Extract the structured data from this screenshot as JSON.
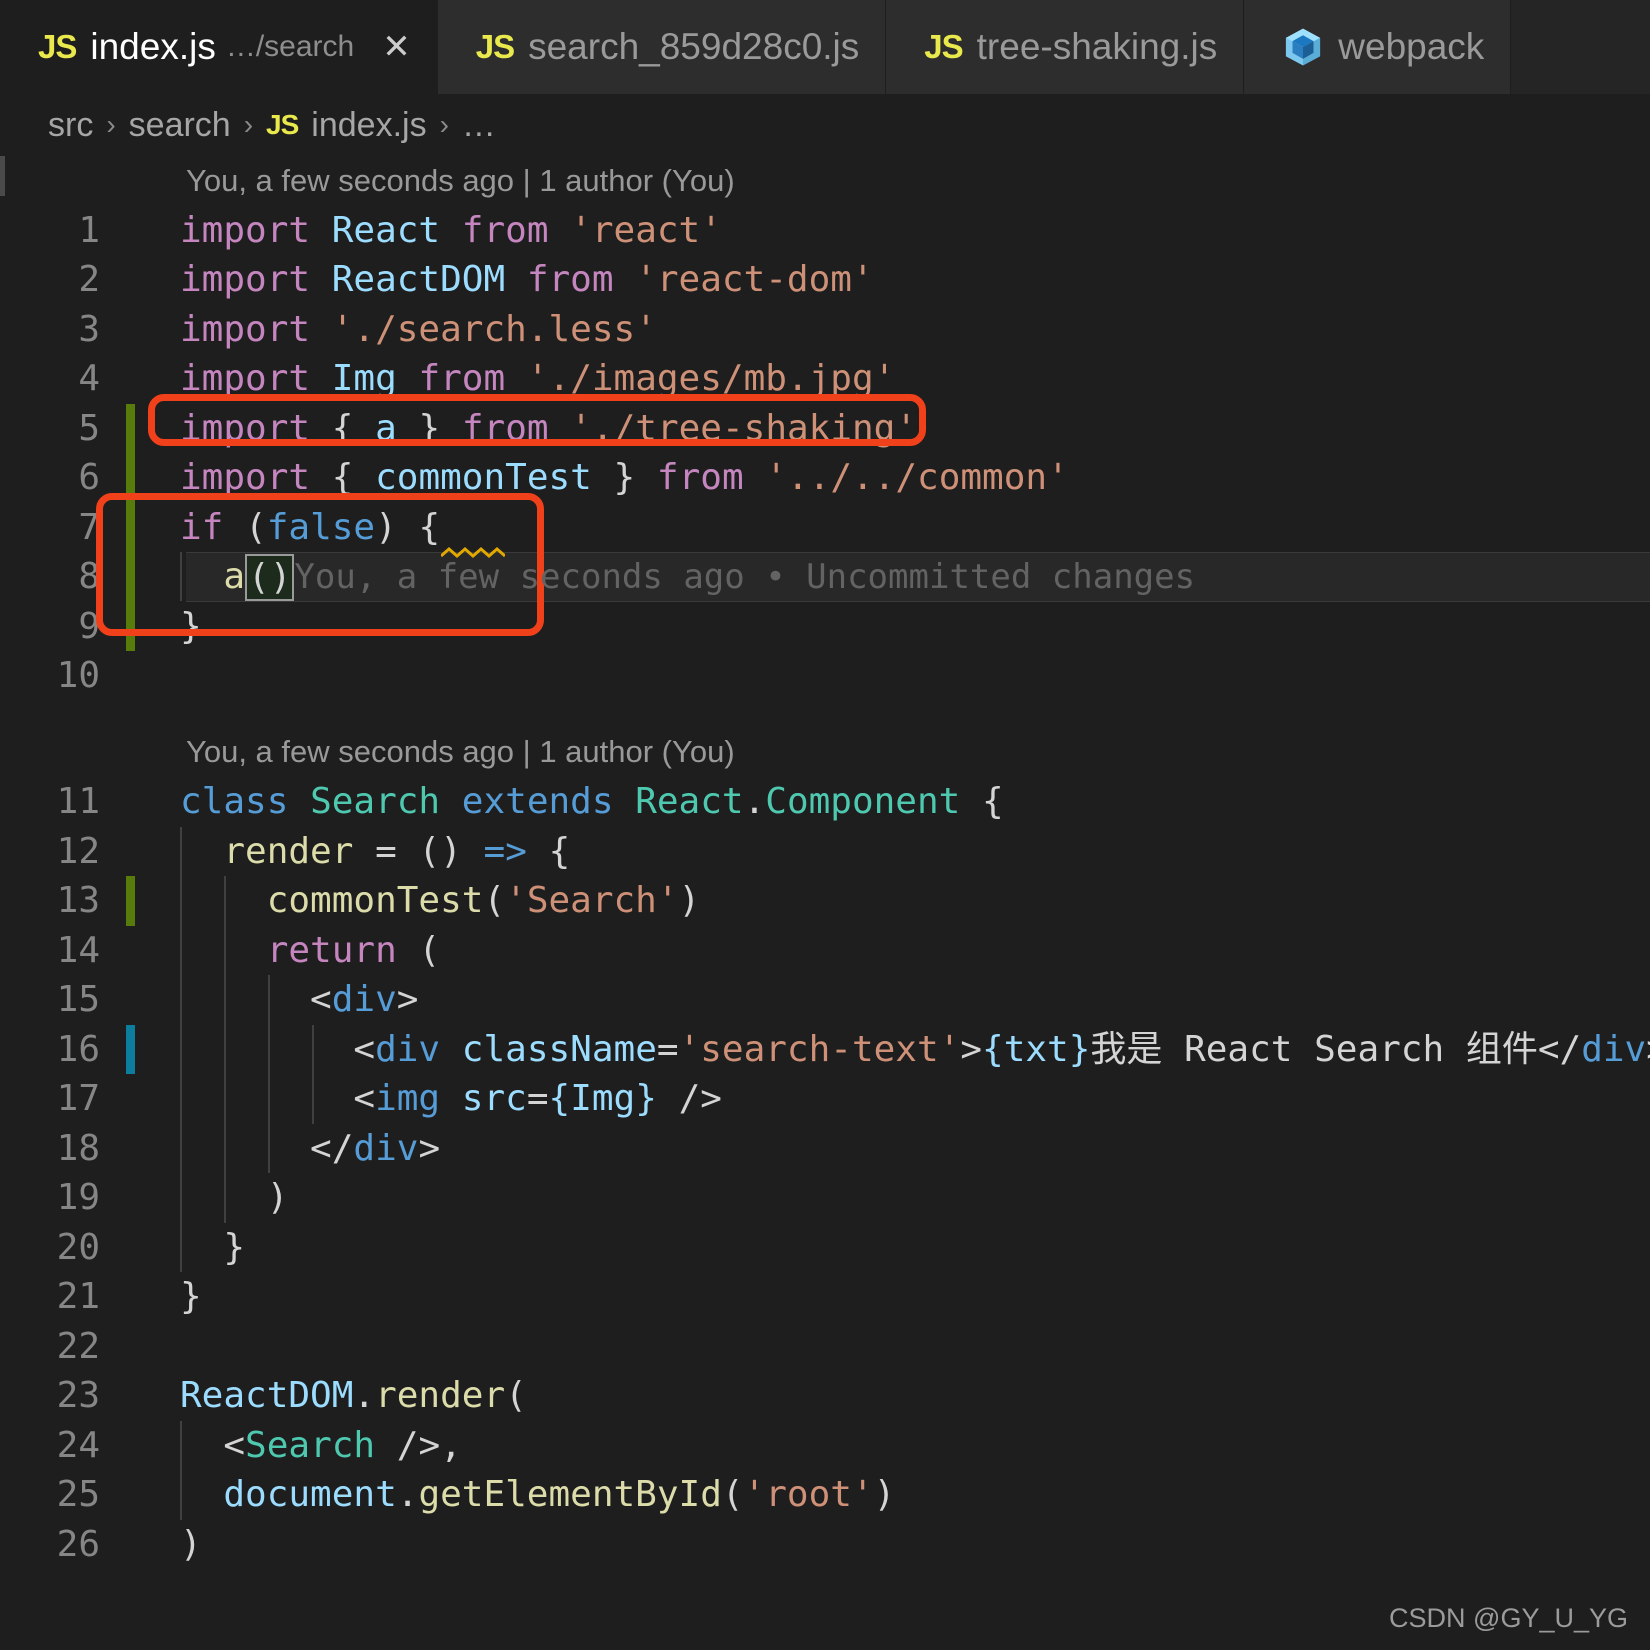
{
  "window": {
    "theme": "vscode-dark",
    "accent_js": "#e9e84c",
    "annotation_color": "#f0411b",
    "git_added_color": "#587c0c",
    "git_modified_color": "#0c7d9d"
  },
  "tabs": [
    {
      "icon": "js-file-icon",
      "label": "index.js",
      "desc": "…/search",
      "active": true,
      "close": "✕"
    },
    {
      "icon": "js-file-icon",
      "label": "search_859d28c0.js",
      "desc": "",
      "active": false,
      "close": ""
    },
    {
      "icon": "js-file-icon",
      "label": "tree-shaking.js",
      "desc": "",
      "active": false,
      "close": ""
    },
    {
      "icon": "webpack-icon",
      "label": "webpack",
      "desc": "",
      "active": false,
      "close": ""
    }
  ],
  "breadcrumb": {
    "parts": [
      "src",
      "search",
      "index.js",
      "…"
    ],
    "separator": "›",
    "file_icon_label": "JS"
  },
  "blame_headers": {
    "top": "You, a few seconds ago | 1 author (You)",
    "class": "You, a few seconds ago | 1 author (You)",
    "inline_line8": "You, a few seconds ago • Uncommitted changes"
  },
  "code_lines": [
    {
      "n": 1,
      "git": "none",
      "text": "import React from 'react'"
    },
    {
      "n": 2,
      "git": "none",
      "text": "import ReactDOM from 'react-dom'"
    },
    {
      "n": 3,
      "git": "none",
      "text": "import './search.less'"
    },
    {
      "n": 4,
      "git": "none",
      "text": "import Img from './images/mb.jpg'"
    },
    {
      "n": 5,
      "git": "added",
      "text": "import { a } from './tree-shaking'"
    },
    {
      "n": 6,
      "git": "added",
      "text": "import { commonTest } from '../../common'"
    },
    {
      "n": 7,
      "git": "added",
      "text": "if (false) {"
    },
    {
      "n": 8,
      "git": "added",
      "text": "  a()"
    },
    {
      "n": 9,
      "git": "added",
      "text": "}"
    },
    {
      "n": 10,
      "git": "none",
      "text": ""
    },
    {
      "n": 11,
      "git": "none",
      "text": "class Search extends React.Component {"
    },
    {
      "n": 12,
      "git": "none",
      "text": "  render = () => {"
    },
    {
      "n": 13,
      "git": "added",
      "text": "    commonTest('Search')"
    },
    {
      "n": 14,
      "git": "none",
      "text": "    return ("
    },
    {
      "n": 15,
      "git": "none",
      "text": "      <div>"
    },
    {
      "n": 16,
      "git": "modified",
      "text": "        <div className='search-text'>{txt}我是 React Search 组件</div>"
    },
    {
      "n": 17,
      "git": "none",
      "text": "        <img src={Img} />"
    },
    {
      "n": 18,
      "git": "none",
      "text": "      </div>"
    },
    {
      "n": 19,
      "git": "none",
      "text": "    )"
    },
    {
      "n": 20,
      "git": "none",
      "text": "  }"
    },
    {
      "n": 21,
      "git": "none",
      "text": "}"
    },
    {
      "n": 22,
      "git": "none",
      "text": ""
    },
    {
      "n": 23,
      "git": "none",
      "text": "ReactDOM.render("
    },
    {
      "n": 24,
      "git": "none",
      "text": "  <Search />,"
    },
    {
      "n": 25,
      "git": "none",
      "text": "  document.getElementById('root')"
    },
    {
      "n": 26,
      "git": "none",
      "text": ")"
    }
  ],
  "annotations": [
    {
      "name": "import-tree-shaking-highlight",
      "target_lines": [
        5
      ]
    },
    {
      "name": "if-false-block-highlight",
      "target_lines": [
        7,
        8,
        9
      ]
    }
  ],
  "watermark": "CSDN @GY_U_YG"
}
